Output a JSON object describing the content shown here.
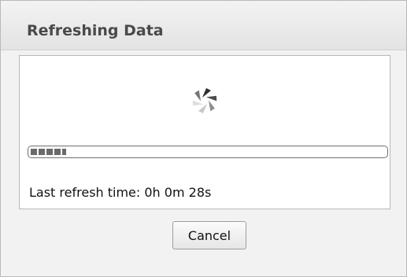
{
  "dialog": {
    "title": "Refreshing Data"
  },
  "loading": {
    "icon": "spinner-icon",
    "progress_fraction": 0.1
  },
  "status": {
    "text": "Last refresh time: 0h 0m 28s"
  },
  "actions": {
    "cancel_label": "Cancel"
  }
}
